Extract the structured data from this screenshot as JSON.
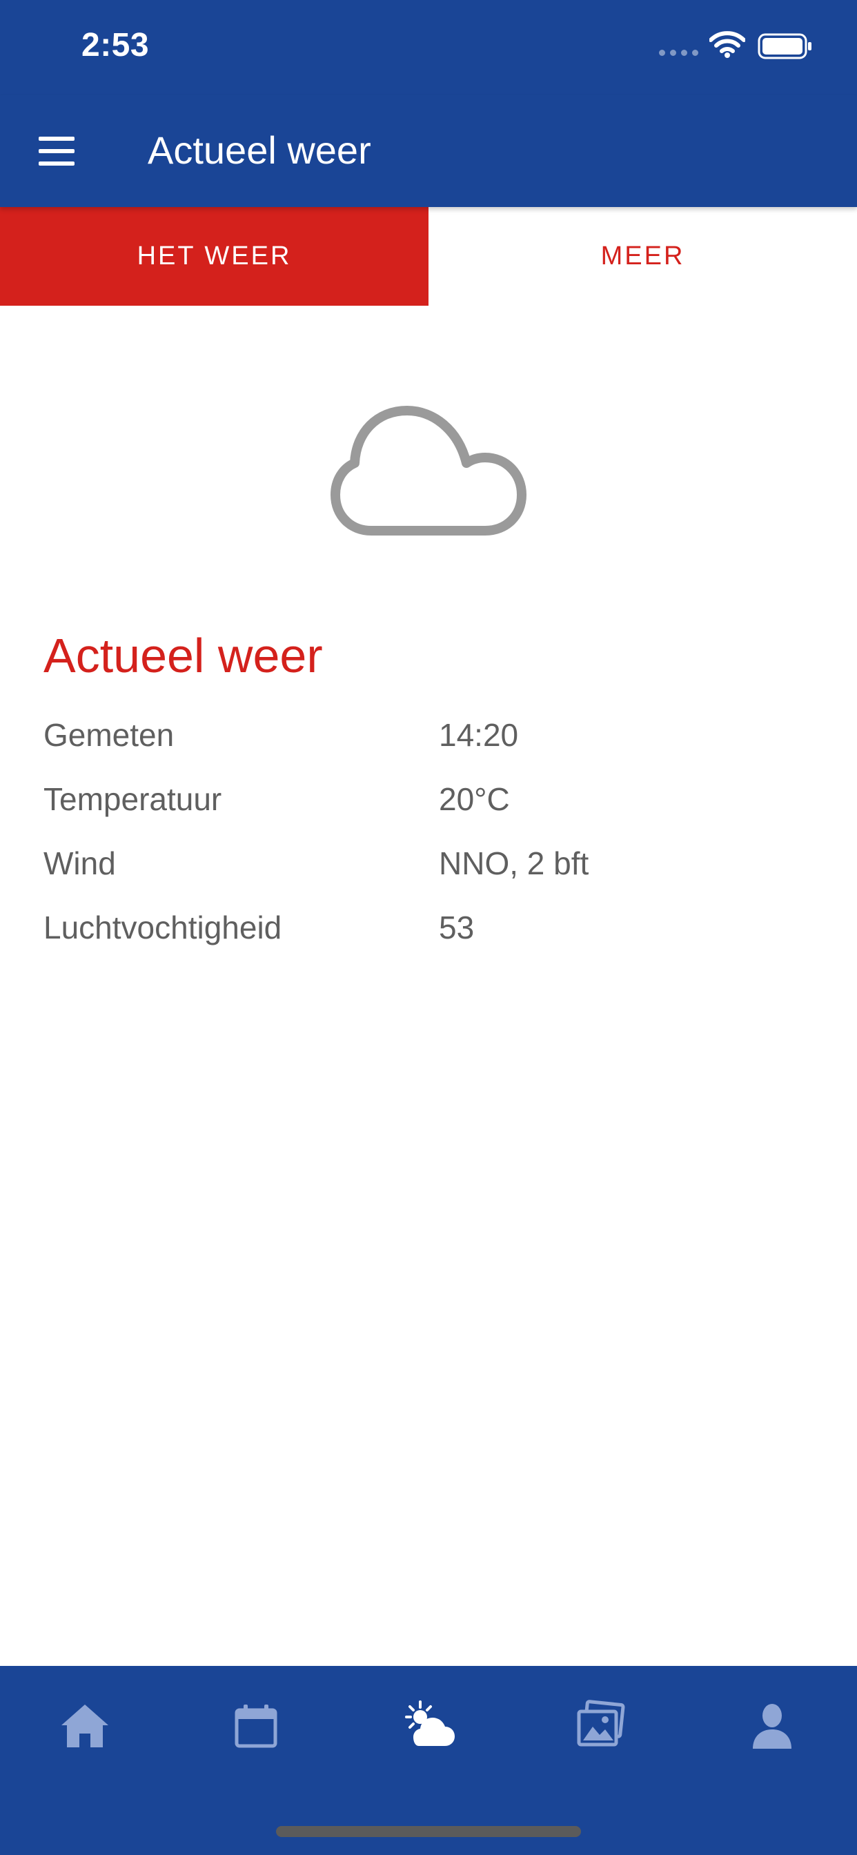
{
  "status_bar": {
    "time": "2:53"
  },
  "app_bar": {
    "title": "Actueel weer",
    "menu_icon": "hamburger-menu-icon"
  },
  "tabs": [
    {
      "label": "HET WEER",
      "active": true
    },
    {
      "label": "MEER",
      "active": false
    }
  ],
  "weather": {
    "condition_icon": "cloud-icon",
    "title": "Actueel weer",
    "rows": [
      {
        "label": "Gemeten",
        "value": "14:20"
      },
      {
        "label": "Temperatuur",
        "value": "20°C"
      },
      {
        "label": "Wind",
        "value": "NNO, 2 bft"
      },
      {
        "label": "Luchtvochtigheid",
        "value": "53"
      }
    ]
  },
  "bottom_nav": {
    "items": [
      {
        "icon": "home-icon",
        "active": false
      },
      {
        "icon": "calendar-icon",
        "active": false
      },
      {
        "icon": "weather-icon",
        "active": true
      },
      {
        "icon": "photos-icon",
        "active": false
      },
      {
        "icon": "profile-icon",
        "active": false
      }
    ]
  },
  "colors": {
    "primary_blue": "#1a4596",
    "accent_red": "#d4211c",
    "text_gray": "#5f5f5f",
    "icon_inactive": "#8fa6d6",
    "icon_active": "#ffffff"
  }
}
